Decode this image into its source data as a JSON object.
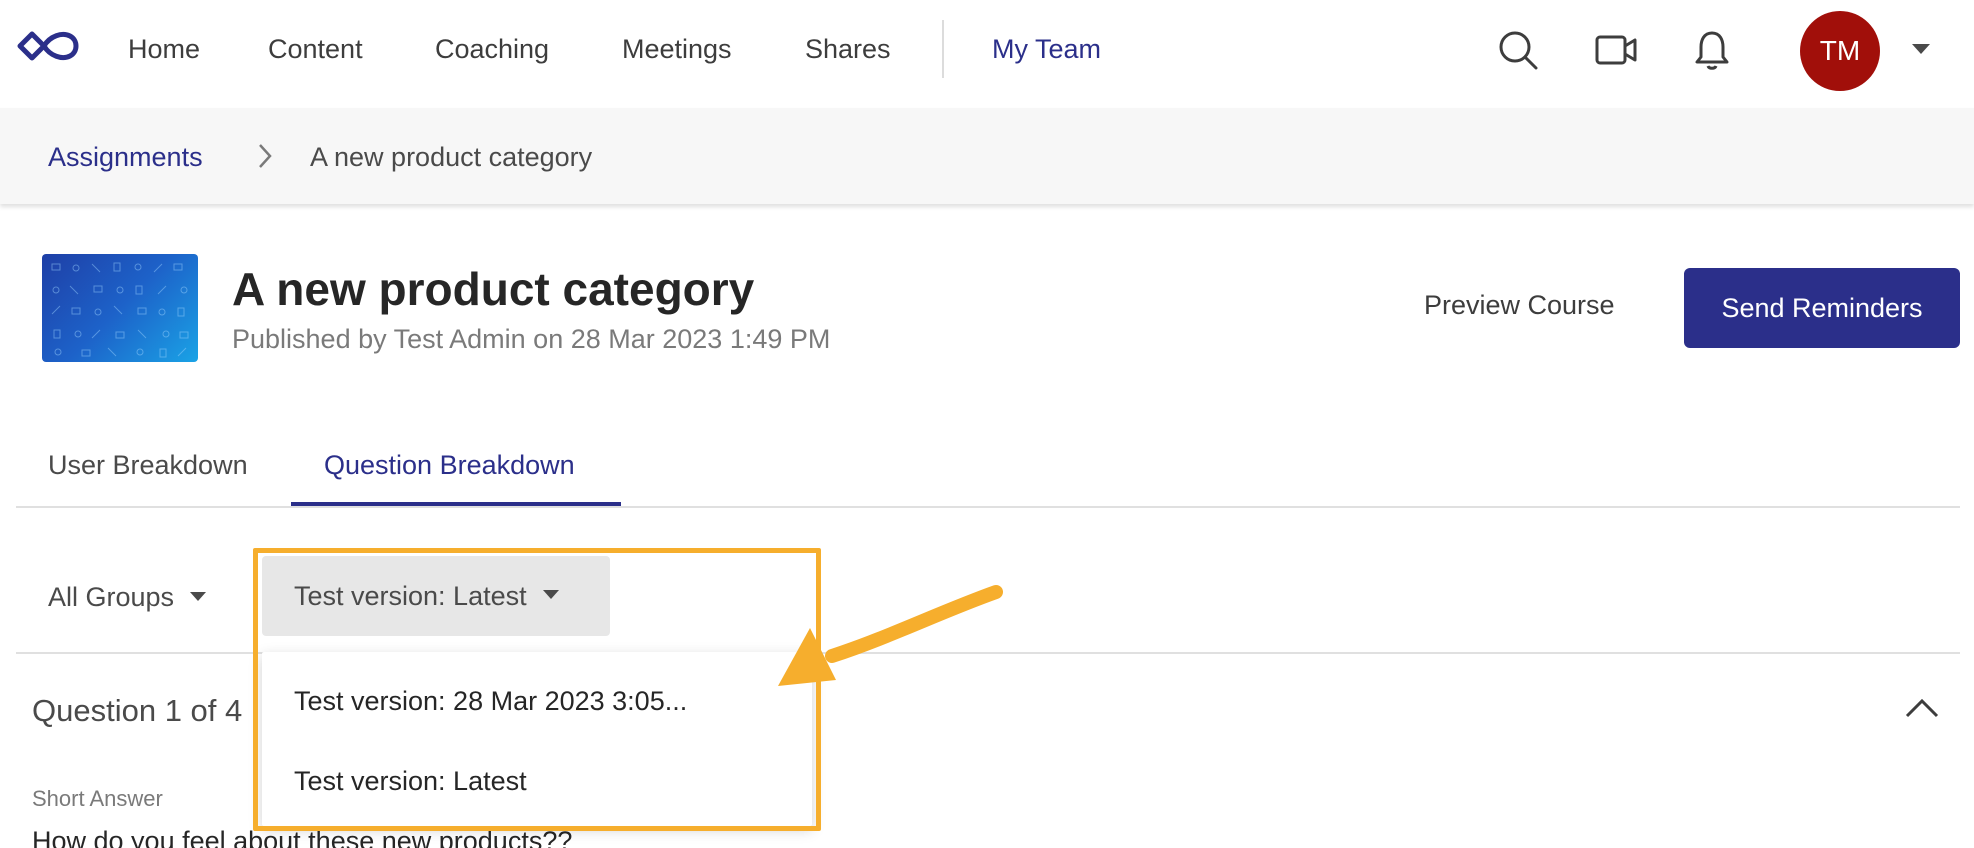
{
  "nav": {
    "items": [
      "Home",
      "Content",
      "Coaching",
      "Meetings",
      "Shares"
    ],
    "active_item": "My Team",
    "user_initials": "TM",
    "avatar_color": "#a10f0a",
    "icons": [
      "search-icon",
      "video-icon",
      "bell-icon",
      "chevron-down-icon"
    ]
  },
  "breadcrumb": {
    "parent": "Assignments",
    "current": "A new product category"
  },
  "header": {
    "title": "A new product category",
    "subtitle": "Published by Test Admin on 28 Mar 2023 1:49 PM",
    "preview_label": "Preview Course",
    "send_label": "Send Reminders"
  },
  "tabs": [
    {
      "label": "User Breakdown",
      "active": false
    },
    {
      "label": "Question Breakdown",
      "active": true
    }
  ],
  "filters": {
    "groups_label": "All Groups",
    "version_label": "Test version: Latest"
  },
  "dropdown": {
    "options": [
      "Test version: 28 Mar 2023 3:05...",
      "Test version: Latest"
    ]
  },
  "question": {
    "count_label": "Question 1 of 4",
    "type_label": "Short Answer",
    "text": "How do you feel about these new products??"
  },
  "colors": {
    "brand": "#2b2f8a",
    "annotation": "#f6ae2d"
  }
}
